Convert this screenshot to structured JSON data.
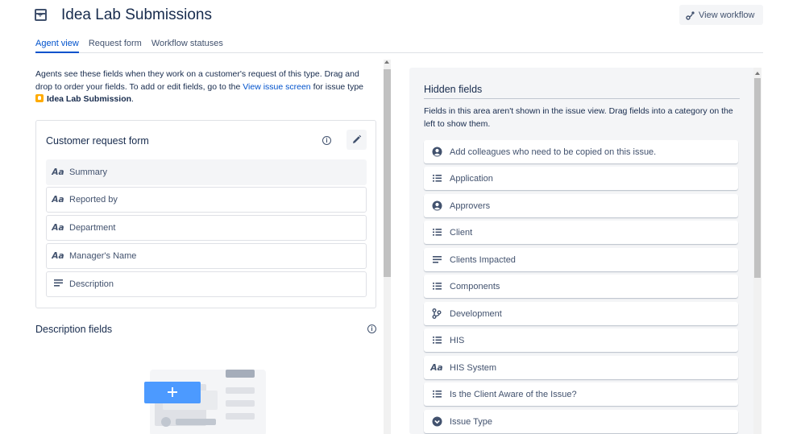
{
  "header": {
    "title": "Idea Lab Submissions",
    "title_icon": "request-type-icon",
    "view_workflow_label": "View workflow"
  },
  "tabs": [
    {
      "label": "Agent view",
      "active": true
    },
    {
      "label": "Request form",
      "active": false
    },
    {
      "label": "Workflow statuses",
      "active": false
    }
  ],
  "intro": {
    "text_before_link": "Agents see these fields when they work on a customer's request of this type. Drag and drop to order your fields. To add or edit fields, go to the ",
    "link_text": "View issue screen",
    "text_after_link": " for issue type",
    "issue_type_name": "Idea Lab Submission",
    "period": "."
  },
  "customer_request_form": {
    "title": "Customer request form",
    "fields": [
      {
        "label": "Summary",
        "icon": "text-field-icon"
      },
      {
        "label": "Reported by",
        "icon": "text-field-icon"
      },
      {
        "label": "Department",
        "icon": "text-field-icon"
      },
      {
        "label": "Manager's Name",
        "icon": "text-field-icon"
      },
      {
        "label": "Description",
        "icon": "paragraph-icon"
      }
    ]
  },
  "description_fields": {
    "title": "Description fields"
  },
  "hidden_fields": {
    "title": "Hidden fields",
    "description": "Fields in this area aren't shown in the issue view. Drag fields into a category on the left to show them.",
    "items": [
      {
        "label": "Add colleagues who need to be copied on this issue.",
        "icon": "person-icon"
      },
      {
        "label": "Application",
        "icon": "list-icon"
      },
      {
        "label": "Approvers",
        "icon": "person-icon"
      },
      {
        "label": "Client",
        "icon": "list-icon"
      },
      {
        "label": "Clients Impacted",
        "icon": "paragraph-icon"
      },
      {
        "label": "Components",
        "icon": "list-icon"
      },
      {
        "label": "Development",
        "icon": "branch-icon"
      },
      {
        "label": "HIS",
        "icon": "list-icon"
      },
      {
        "label": "HIS System",
        "icon": "text-field-icon"
      },
      {
        "label": "Is the Client Aware of the Issue?",
        "icon": "list-icon"
      },
      {
        "label": "Issue Type",
        "icon": "chevron-circle-icon"
      }
    ]
  },
  "text_field_glyph": "Aa",
  "colors": {
    "link": "#0052cc",
    "text": "#172b4d",
    "subtle_text": "#42526e",
    "panel_bg": "#f4f5f7",
    "issue_type_icon": "#ffab00",
    "illustration_blue": "#4c9aff"
  }
}
